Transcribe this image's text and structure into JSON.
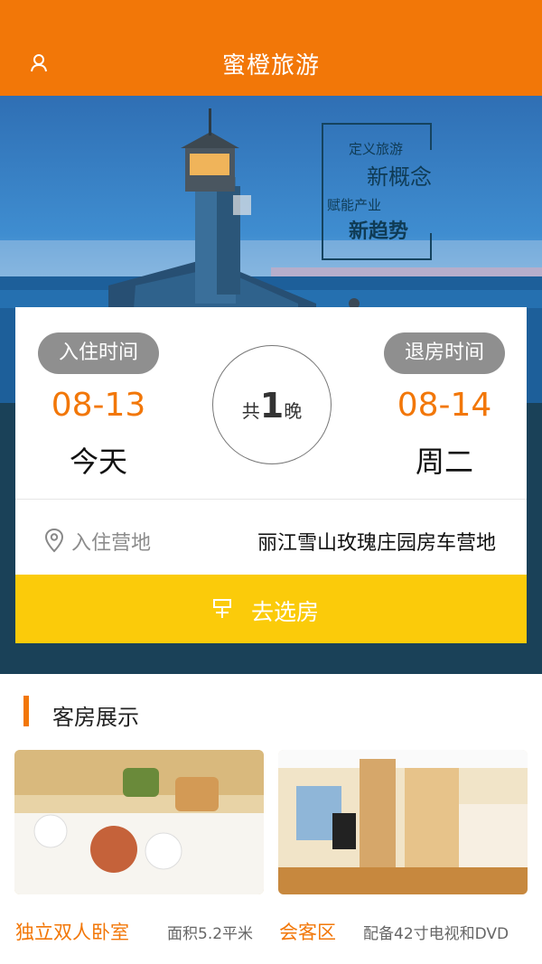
{
  "header": {
    "title": "蜜橙旅游"
  },
  "hero": {
    "slogan_line1": "定义旅游",
    "slogan_line2": "新概念",
    "slogan_line3": "赋能产业",
    "slogan_line4": "新趋势"
  },
  "booking": {
    "checkin_label": "入住时间",
    "checkout_label": "退房时间",
    "checkin_date": "08-13",
    "checkout_date": "08-14",
    "checkin_day": "今天",
    "checkout_day": "周二",
    "nights_prefix": "共",
    "nights_count": "1",
    "nights_suffix": "晚",
    "camp_label": "入住营地",
    "camp_value": "丽江雪山玫瑰庄园房车营地",
    "cta_label": "去选房"
  },
  "rooms_section": {
    "title": "客房展示",
    "rooms": [
      {
        "name": "独立双人卧室",
        "desc": "面积5.2平米"
      },
      {
        "name": "会客区",
        "desc": "配备42寸电视和DVD"
      }
    ]
  },
  "colors": {
    "brand_orange": "#f27708",
    "cta_yellow": "#fbcb0a",
    "pill_gray": "#8f8f8f",
    "navy": "#1a4158"
  },
  "icons": {
    "user": "user-icon",
    "location": "location-pin-icon",
    "cta": "bed-icon"
  }
}
